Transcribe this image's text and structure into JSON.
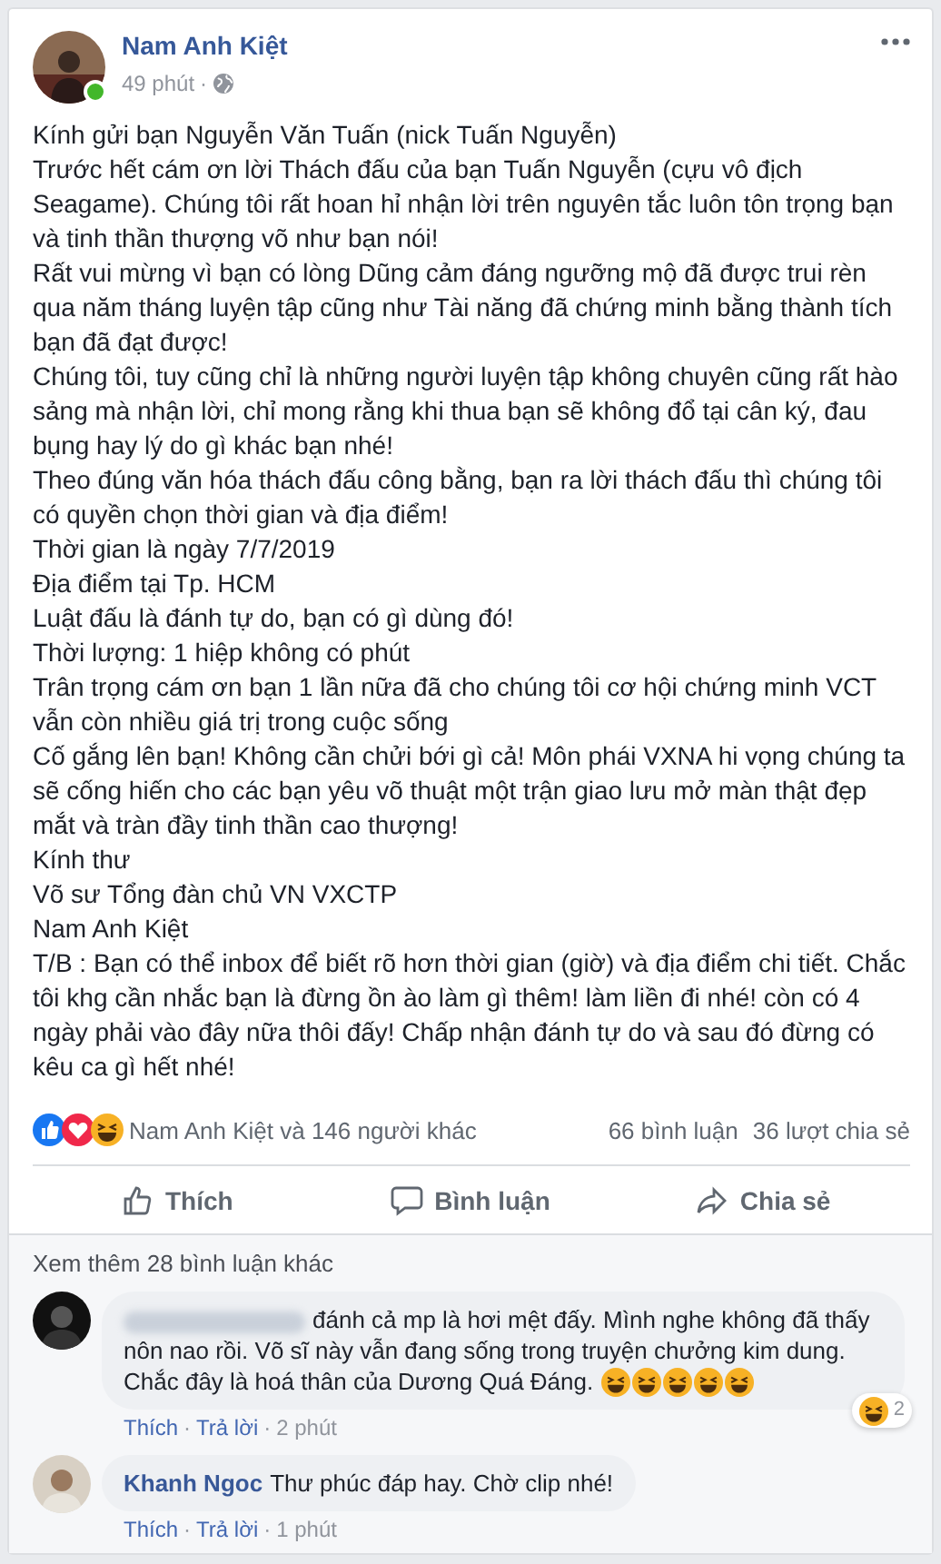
{
  "post": {
    "author": "Nam Anh Kiệt",
    "online": true,
    "time": "49 phút",
    "time_separator": "·",
    "paragraphs": [
      "Kính gửi bạn Nguyễn Văn Tuấn (nick Tuấn Nguyễn)",
      "Trước hết cám ơn lời Thách đấu của bạn Tuấn Nguyễn (cựu vô địch Seagame). Chúng tôi rất hoan hỉ nhận lời trên nguyên tắc luôn tôn trọng bạn và tinh thần thượng võ như bạn nói!",
      "Rất vui mừng vì bạn có lòng Dũng cảm đáng ngưỡng mộ đã được trui rèn qua năm tháng luyện tập cũng như Tài năng đã chứng minh bằng thành tích bạn đã đạt được!",
      "Chúng tôi, tuy cũng chỉ là những người luyện tập không chuyên cũng rất hào sảng mà nhận lời, chỉ mong rằng khi thua bạn sẽ không đổ tại cân ký, đau bụng hay lý do gì khác bạn nhé!",
      "Theo đúng văn hóa thách đấu công bằng, bạn ra lời thách đấu thì chúng tôi có quyền chọn thời gian và địa điểm!",
      "Thời gian là ngày 7/7/2019",
      "Địa điểm tại Tp. HCM",
      "Luật đấu là đánh tự do, bạn có gì dùng đó!",
      "Thời lượng: 1 hiệp không có phút",
      "Trân trọng cám ơn bạn 1 lần nữa đã cho chúng tôi cơ hội chứng minh VCT vẫn còn nhiều giá trị trong cuộc sống",
      "Cố gắng lên bạn! Không cần chửi bới gì cả! Môn phái VXNA hi vọng chúng ta sẽ cống hiến cho các bạn yêu võ thuật một trận giao lưu mở màn thật đẹp mắt và tràn đầy tinh thần cao thượng!",
      "Kính thư",
      "Võ sư Tổng đàn chủ VN VXCTP",
      "Nam Anh Kiệt",
      "T/B : Bạn có thể inbox để biết rõ hơn thời gian (giờ) và địa điểm chi tiết. Chắc tôi khg cần nhắc bạn là đừng ồn ào làm gì thêm! làm liền đi nhé! còn có 4 ngày phải vào đây nữa thôi đấy! Chấp nhận đánh tự do và sau đó đừng có kêu ca gì hết nhé!"
    ],
    "reactions": [
      {
        "kind": "like"
      },
      {
        "kind": "love"
      },
      {
        "kind": "haha"
      }
    ],
    "reaction_summary": "Nam Anh Kiệt và 146 người khác",
    "comment_count": "66 bình luận",
    "share_count": "36 lượt chia sẻ",
    "actions": [
      {
        "kind": "like",
        "label": "Thích"
      },
      {
        "kind": "comment",
        "label": "Bình luận"
      },
      {
        "kind": "share",
        "label": "Chia sẻ"
      }
    ]
  },
  "comments": {
    "more": "Xem thêm 28 bình luận khác",
    "items": [
      {
        "name_blurred": true,
        "text": "đánh cả mp là hơi mệt đấy. Mình nghe không đã thấy nôn nao rồi. Võ sĩ này vẫn đang sống trong truyện chưởng kim dung.",
        "text_end": "Chắc đây là hoá thân của Dương Quá Đáng.",
        "emojis": [
          {
            "kind": "haha"
          },
          {
            "kind": "haha"
          },
          {
            "kind": "haha"
          },
          {
            "kind": "haha"
          },
          {
            "kind": "haha"
          }
        ],
        "reaction": {
          "kind": "haha",
          "count": "2"
        },
        "actions": [
          "Thích",
          "Trả lời",
          "2 phút"
        ],
        "separators": [
          "·",
          "·"
        ]
      },
      {
        "author": "Khanh Ngoc",
        "text": "Thư phúc đáp hay. Chờ clip nhé!",
        "actions": [
          "Thích",
          "Trả lời",
          "1 phút"
        ],
        "separators": [
          "·",
          "·"
        ]
      }
    ]
  }
}
